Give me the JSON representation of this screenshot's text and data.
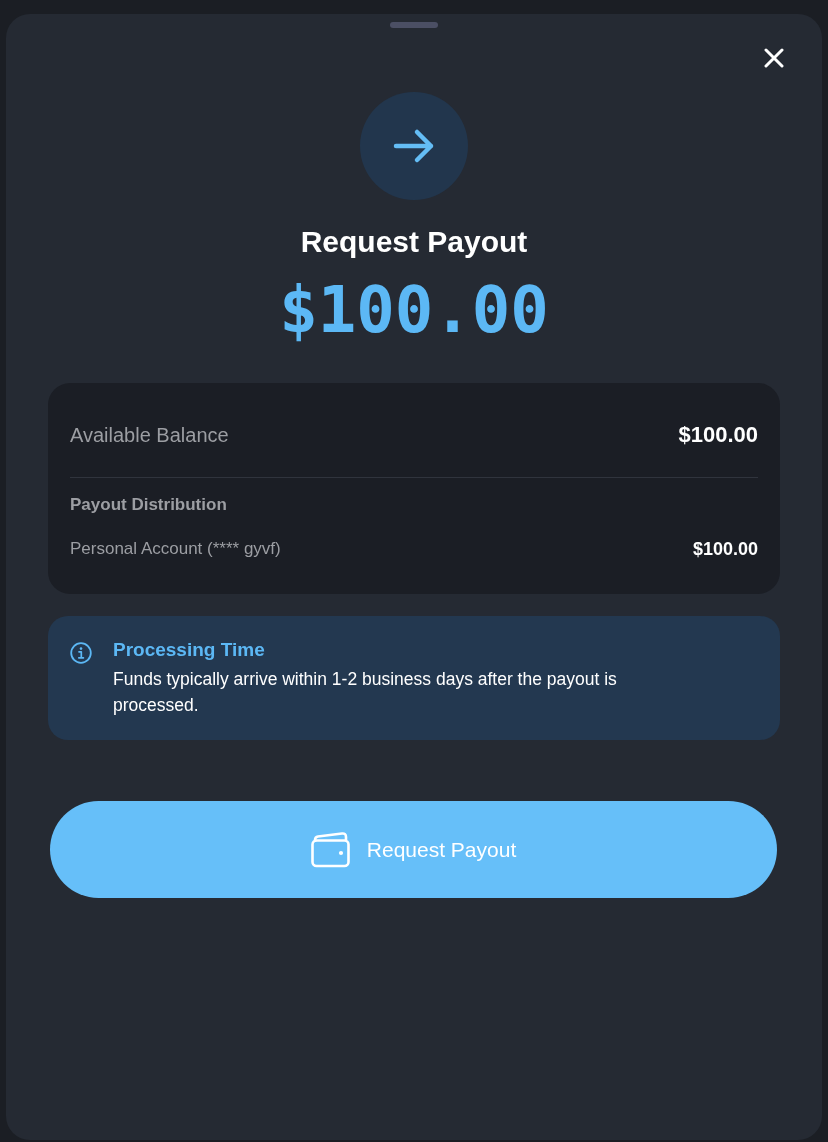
{
  "header": {
    "title": "Request Payout",
    "amount": "$100.00"
  },
  "balance_card": {
    "label": "Available Balance",
    "value": "$100.00",
    "distribution": {
      "heading": "Payout Distribution",
      "items": [
        {
          "account": "Personal Account (**** gyvf)",
          "amount": "$100.00"
        }
      ]
    }
  },
  "info": {
    "title": "Processing Time",
    "text": "Funds typically arrive within 1-2 business days after the payout is processed."
  },
  "primary_button": {
    "label": "Request Payout"
  }
}
